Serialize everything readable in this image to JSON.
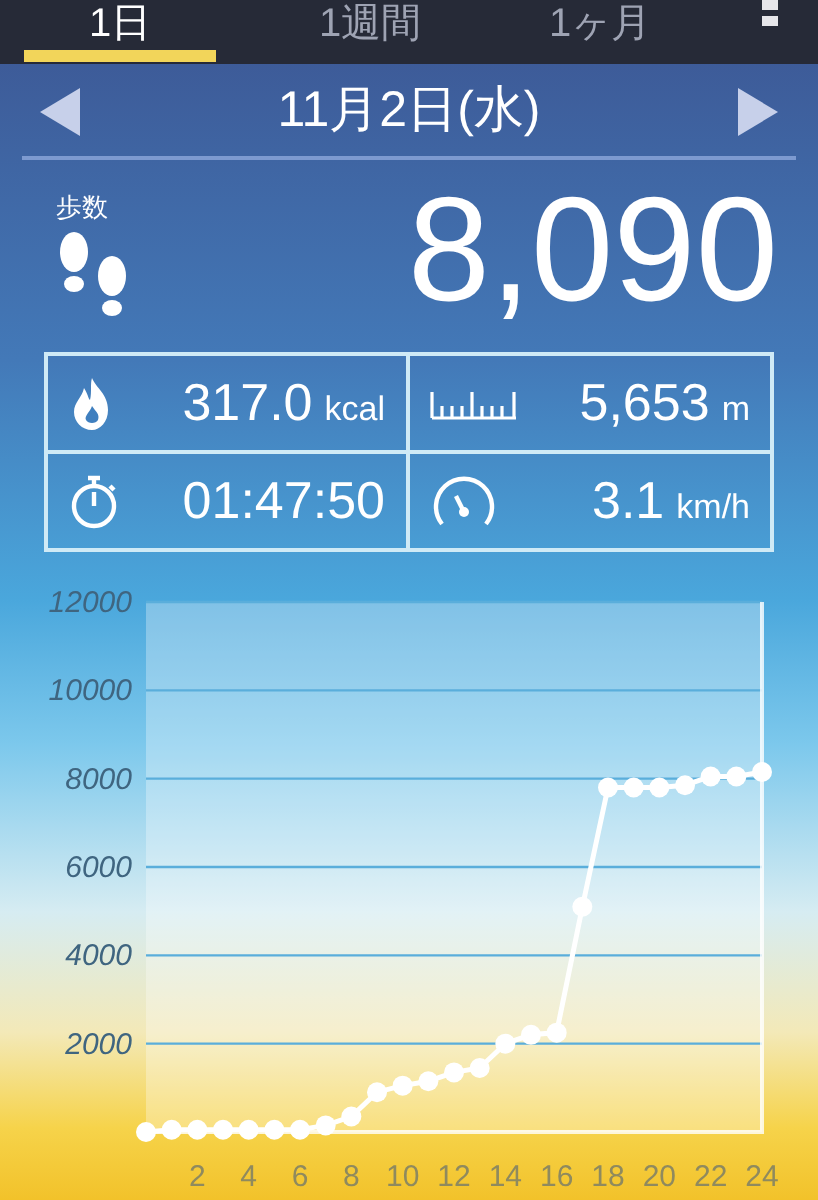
{
  "tabs": [
    {
      "label": "1日",
      "selected": true
    },
    {
      "label": "1週間",
      "selected": false
    },
    {
      "label": "1ヶ月",
      "selected": false
    }
  ],
  "date_nav": {
    "date": "11月2日(水)"
  },
  "steps": {
    "label": "歩数",
    "value": "8,090"
  },
  "stats": [
    {
      "kind": "calories",
      "value": "317.0",
      "unit": "kcal"
    },
    {
      "kind": "distance",
      "value": "5,653",
      "unit": "m"
    },
    {
      "kind": "time",
      "value": "01:47:50"
    },
    {
      "kind": "speed",
      "value": "3.1",
      "unit": "km/h"
    }
  ],
  "chart_data": {
    "type": "line",
    "x": [
      0,
      1,
      2,
      3,
      4,
      5,
      6,
      7,
      8,
      9,
      10,
      11,
      12,
      13,
      14,
      15,
      16,
      17,
      18,
      19,
      20,
      21,
      22,
      23,
      24
    ],
    "grid": true,
    "marker": true,
    "series": [
      {
        "color": "#ffffff",
        "values": [
          0,
          50,
          50,
          50,
          50,
          50,
          50,
          150,
          350,
          900,
          1050,
          1150,
          1350,
          1450,
          2000,
          2200,
          2250,
          5100,
          7800,
          7800,
          7800,
          7850,
          8050,
          8050,
          8150
        ]
      }
    ],
    "xlim": [
      0,
      24
    ],
    "ylim": [
      0,
      12000
    ],
    "xticks": [
      2,
      4,
      6,
      8,
      10,
      12,
      14,
      16,
      18,
      20,
      22,
      24
    ],
    "yticks": [
      2000,
      4000,
      6000,
      8000,
      10000,
      12000
    ]
  }
}
